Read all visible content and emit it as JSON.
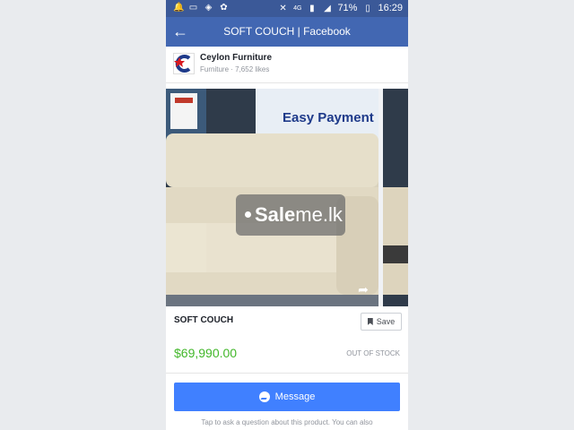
{
  "status_bar": {
    "network": "4G",
    "battery": "71%",
    "time": "16:29"
  },
  "app_bar": {
    "title": "SOFT COUCH | Facebook"
  },
  "page": {
    "name": "Ceylon Furniture",
    "meta": "Furniture · 7,652 likes"
  },
  "gallery": {
    "watermark_bold": "Sale",
    "watermark_rest": "me.lk",
    "banner_text": "Easy Payment"
  },
  "product": {
    "title": "SOFT COUCH",
    "save_label": "Save",
    "price": "$69,990.00",
    "stock_status": "OUT OF STOCK"
  },
  "message_button": {
    "label": "Message"
  },
  "hint_text": "Tap to ask a question about this product. You can also",
  "colors": {
    "status_bar": "#3b5998",
    "app_bar": "#4267b2",
    "price": "#42b72a",
    "message_button": "#4080ff"
  }
}
